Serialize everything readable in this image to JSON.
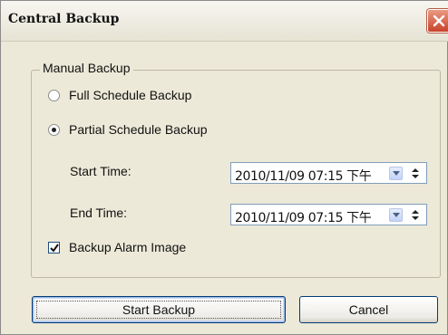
{
  "window": {
    "title": "Central Backup",
    "close_icon": "close-icon"
  },
  "group": {
    "label": "Manual Backup"
  },
  "options": {
    "full_label": "Full Schedule Backup",
    "partial_label": "Partial Schedule Backup",
    "selected": "partial"
  },
  "start_time": {
    "label": "Start Time:",
    "value": "2010/11/09 07:15 下午"
  },
  "end_time": {
    "label": "End Time:",
    "value": "2010/11/09 07:15 下午"
  },
  "alarm_image": {
    "label": "Backup Alarm Image",
    "checked": true
  },
  "buttons": {
    "start": "Start Backup",
    "cancel": "Cancel"
  }
}
